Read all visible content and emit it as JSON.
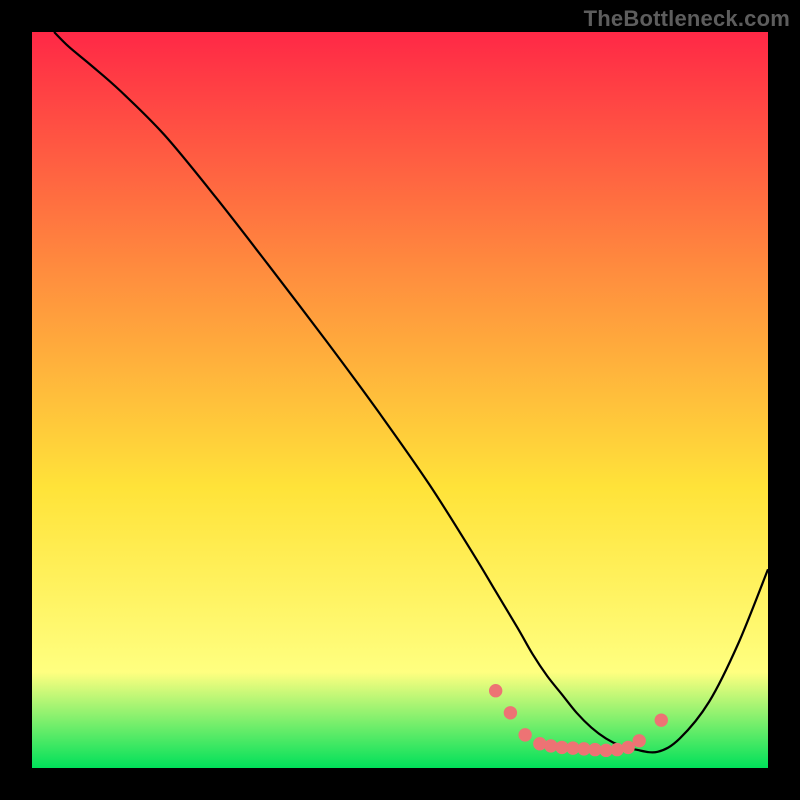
{
  "brand": "TheBottleneck.com",
  "colors": {
    "frame_bg": "#000000",
    "curve_stroke": "#000000",
    "marker_fill": "#ed7374",
    "marker_stroke": "#ed7374",
    "gradient_top": "#ff2846",
    "gradient_mid1": "#ff8b3e",
    "gradient_mid2": "#ffe339",
    "gradient_mid3": "#ffff80",
    "gradient_bottom": "#00e05a"
  },
  "chart_data": {
    "type": "line",
    "title": "",
    "xlabel": "",
    "ylabel": "",
    "xlim": [
      0,
      100
    ],
    "ylim": [
      0,
      100
    ],
    "grid": false,
    "legend": false,
    "series": [
      {
        "name": "curve",
        "x": [
          3,
          5,
          8,
          12,
          18,
          25,
          32,
          40,
          47,
          54,
          60,
          63,
          66,
          68,
          70,
          72,
          74,
          76,
          78,
          80,
          82,
          85,
          88,
          92,
          96,
          100
        ],
        "y": [
          100,
          98,
          95.5,
          92,
          86,
          77.5,
          68.5,
          58,
          48.5,
          38.5,
          29,
          24,
          19,
          15.5,
          12.5,
          10,
          7.5,
          5.5,
          4,
          3,
          2.5,
          2.2,
          4,
          9,
          17,
          27
        ]
      }
    ],
    "markers": [
      {
        "x": 63,
        "y": 10.5
      },
      {
        "x": 65,
        "y": 7.5
      },
      {
        "x": 67,
        "y": 4.5
      },
      {
        "x": 69,
        "y": 3.3
      },
      {
        "x": 70.5,
        "y": 3.0
      },
      {
        "x": 72,
        "y": 2.8
      },
      {
        "x": 73.5,
        "y": 2.7
      },
      {
        "x": 75,
        "y": 2.6
      },
      {
        "x": 76.5,
        "y": 2.5
      },
      {
        "x": 78,
        "y": 2.4
      },
      {
        "x": 79.5,
        "y": 2.5
      },
      {
        "x": 81,
        "y": 2.8
      },
      {
        "x": 82.5,
        "y": 3.7
      },
      {
        "x": 85.5,
        "y": 6.5
      }
    ]
  }
}
